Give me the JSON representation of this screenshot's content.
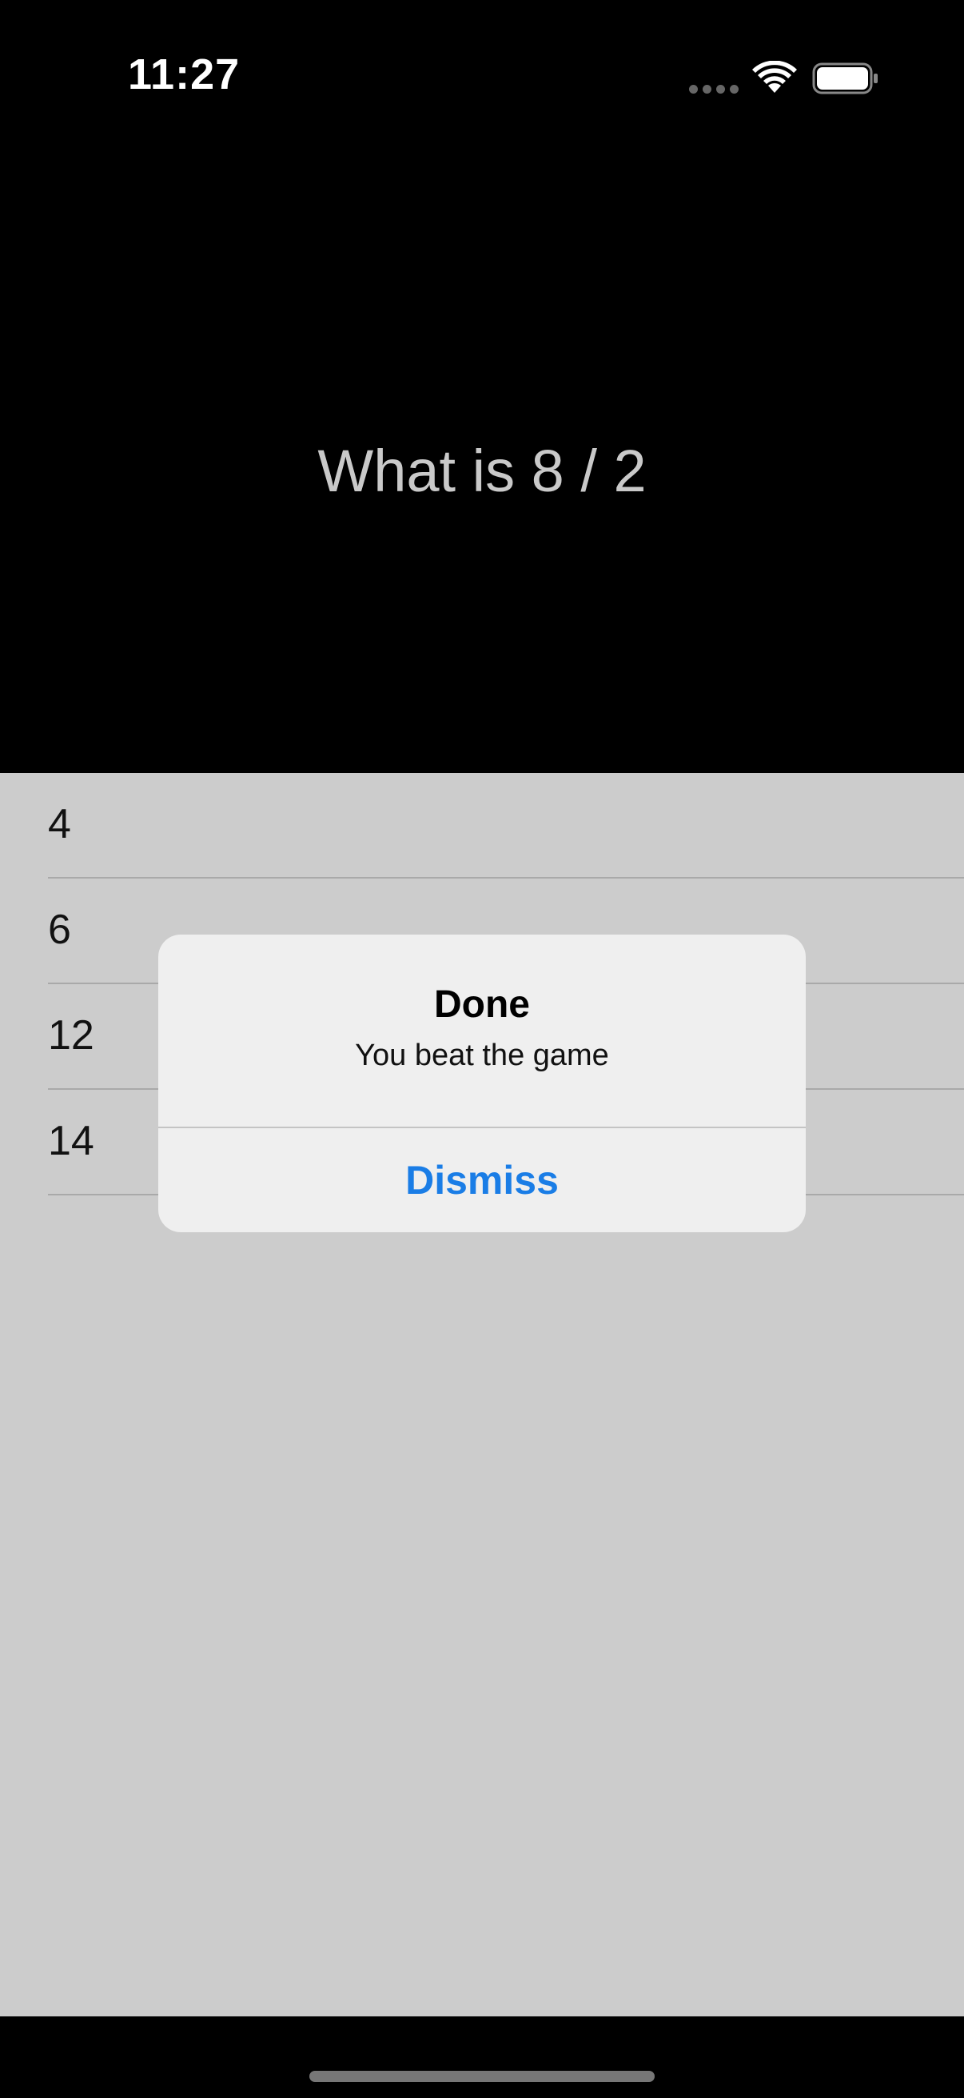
{
  "status_bar": {
    "time": "11:27",
    "icons": [
      "signal-dots-icon",
      "wifi-icon",
      "battery-icon"
    ]
  },
  "question": {
    "text": "What is 8 / 2"
  },
  "answers": [
    {
      "label": "4"
    },
    {
      "label": "6"
    },
    {
      "label": "12"
    },
    {
      "label": "14"
    }
  ],
  "alert": {
    "title": "Done",
    "message": "You beat the game",
    "button_label": "Dismiss"
  },
  "colors": {
    "accent": "#1a7de6",
    "background_top": "#000000",
    "dimmed_list": "#cccccc",
    "alert_background": "#efefef"
  }
}
